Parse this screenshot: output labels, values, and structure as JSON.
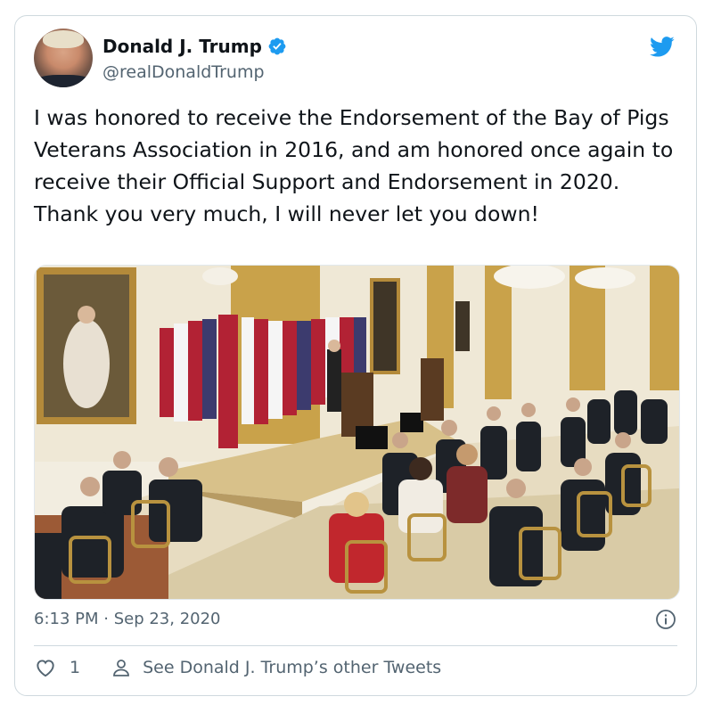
{
  "user": {
    "display_name": "Donald J. Trump",
    "handle": "@realDonaldTrump",
    "verified": true
  },
  "tweet": {
    "text": "I was honored to receive the Endorsement of the Bay of Pigs Veterans Association in 2016, and am honored once again to receive their Official Support and Endorsement in 2020. Thank you very much, I will never let you down!",
    "timestamp": "6:13 PM · Sep 23, 2020"
  },
  "footer": {
    "like_count": "1",
    "see_more_label": "See Donald J. Trump’s other Tweets"
  },
  "colors": {
    "twitter_blue": "#1d9bf0",
    "text_primary": "#0f1419",
    "text_secondary": "#536471",
    "border": "#cfd9de"
  },
  "icons": {
    "brand": "twitter-bird-icon",
    "verified": "verified-badge-icon",
    "info": "info-icon",
    "like": "heart-icon",
    "profile": "person-icon"
  }
}
